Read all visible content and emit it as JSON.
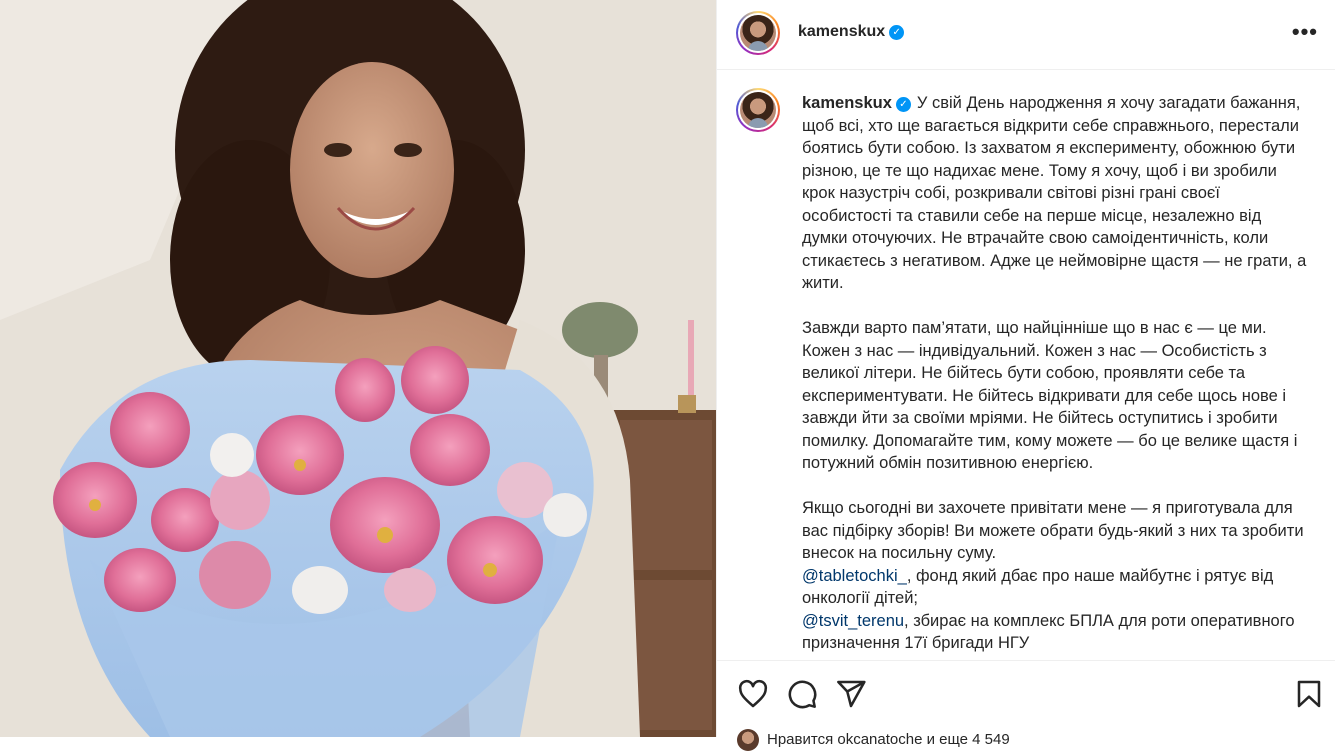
{
  "post": {
    "username": "kamenskux",
    "more_label": "•••",
    "caption": {
      "p1": "У свій День народження я хочу загадати бажання, щоб всі, хто ще вагається відкрити себе справжнього, перестали боятись бути собою. Із захватом я експерименту, обожнюю бути різною, це те що надихає мене. Тому я хочу, щоб і ви зробили крок назустріч собі, розкривали світові різні грані своєї особистості та ставили себе на перше місце, незалежно від думки оточуючих. Не втрачайте свою самоідентичність, коли стикаєтесь з негативом. Адже це неймовірне щастя — не грати, а жити.",
      "p2": "Завжди варто пам’ятати, що найцінніше що в нас є — це ми. Кожен з нас — індивідуальний. Кожен з нас — Особистість з великої літери. Не бійтесь бути собою, проявляти себе та експериментувати. Не бійтесь відкривати для себе щось нове і завжди йти за своїми мріями. Не бійтесь оступитись і зробити помилку. Допомагайте тим, кому можете — бо це велике щастя і потужний обмін позитивною енергією.",
      "p3": "Якщо сьогодні ви захочете привітати мене — я приготувала для вас підбірку зборів! Ви можете обрати будь-який з них та зробити внесок на посильну суму.",
      "mention1": "@tabletochki_",
      "mention1_text": ", фонд який дбає про наше майбутнє і рятує від онкології дітей;",
      "mention2": "@tsvit_terenu",
      "mention2_text": ", збирає на комплекс БПЛА для роти оперативного призначення 17ї бригади НГУ"
    },
    "likes_text": "Нравится okcanatoche и еще 4 549"
  },
  "icons": {
    "like": "heart-icon",
    "comment": "comment-icon",
    "share": "share-icon",
    "save": "bookmark-icon",
    "verified": "verified-badge-icon",
    "more": "more-options-icon"
  },
  "colors": {
    "link": "#00376b",
    "verified": "#0095f6",
    "text": "#262626"
  }
}
